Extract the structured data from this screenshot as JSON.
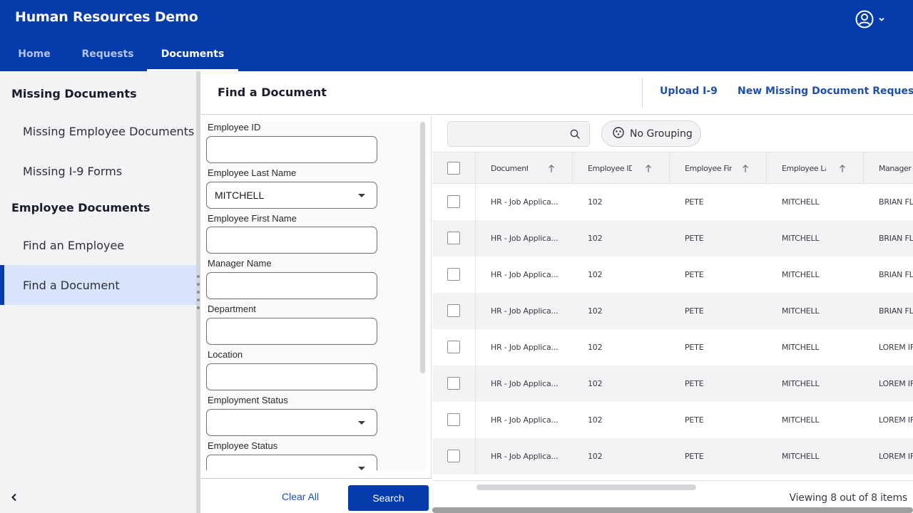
{
  "header": {
    "app_title": "Human Resources Demo",
    "profile_icon": "user-circle-icon",
    "profile_menu_icon": "chevron-down-icon",
    "accent_color": "#053bab"
  },
  "nav": {
    "tabs": [
      {
        "label": "Home",
        "active": false
      },
      {
        "label": "Requests",
        "active": false
      },
      {
        "label": "Documents",
        "active": true
      }
    ]
  },
  "sidebar": {
    "sections": [
      {
        "heading": "Missing Documents",
        "items": [
          {
            "label": "Missing Employee Documents",
            "active": false
          },
          {
            "label": "Missing I-9 Forms",
            "active": false
          }
        ]
      },
      {
        "heading": "Employee Documents",
        "items": [
          {
            "label": "Find an Employee",
            "active": false
          },
          {
            "label": "Find a Document",
            "active": true
          }
        ]
      }
    ],
    "collapse_icon": "chevron-left-icon"
  },
  "page": {
    "title": "Find a Document",
    "actions": [
      {
        "label": "Upload I-9"
      },
      {
        "label": "New Missing Document Request"
      }
    ]
  },
  "filters": {
    "fields": [
      {
        "label": "Employee ID",
        "type": "text",
        "value": ""
      },
      {
        "label": "Employee Last Name",
        "type": "select",
        "value": "MITCHELL"
      },
      {
        "label": "Employee First Name",
        "type": "text",
        "value": ""
      },
      {
        "label": "Manager Name",
        "type": "text",
        "value": ""
      },
      {
        "label": "Department",
        "type": "text",
        "value": ""
      },
      {
        "label": "Location",
        "type": "text",
        "value": ""
      },
      {
        "label": "Employment Status",
        "type": "select",
        "value": ""
      },
      {
        "label": "Employee Status",
        "type": "select",
        "value": ""
      }
    ],
    "clear_label": "Clear All",
    "search_label": "Search"
  },
  "grid": {
    "search_value": "",
    "search_icon": "search-icon",
    "grouping_label": "No Grouping",
    "grouping_icon": "grouping-icon",
    "columns": [
      {
        "label": "Document Ty",
        "sort": "ascending"
      },
      {
        "label": "Employee ID",
        "sort": "ascending"
      },
      {
        "label": "Employee Firs",
        "sort": "ascending"
      },
      {
        "label": "Employee Las",
        "sort": "ascending"
      },
      {
        "label": "Manager I",
        "sort": ""
      }
    ],
    "rows": [
      [
        "HR - Job Applica...",
        "102",
        "PETE",
        "MITCHELL",
        "BRIAN FL"
      ],
      [
        "HR - Job Applica...",
        "102",
        "PETE",
        "MITCHELL",
        "BRIAN FL"
      ],
      [
        "HR - Job Applica...",
        "102",
        "PETE",
        "MITCHELL",
        "BRIAN FL"
      ],
      [
        "HR - Job Applica...",
        "102",
        "PETE",
        "MITCHELL",
        "BRIAN FL"
      ],
      [
        "HR - Job Applica...",
        "102",
        "PETE",
        "MITCHELL",
        "LOREM IF"
      ],
      [
        "HR - Job Applica...",
        "102",
        "PETE",
        "MITCHELL",
        "LOREM IF"
      ],
      [
        "HR - Job Applica...",
        "102",
        "PETE",
        "MITCHELL",
        "LOREM IF"
      ],
      [
        "HR - Job Applica...",
        "102",
        "PETE",
        "MITCHELL",
        "LOREM IF"
      ]
    ],
    "footer_text": "Viewing 8 out of 8 items"
  }
}
